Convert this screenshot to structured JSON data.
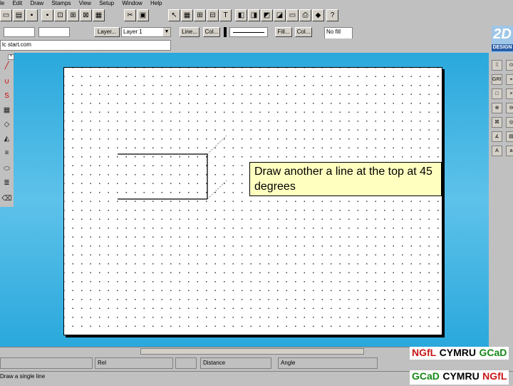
{
  "menu": [
    "le",
    "Edit",
    "Draw",
    "Stamps",
    "View",
    "Setup",
    "Window",
    "Help"
  ],
  "toolbar2": {
    "layer_button": "Layer...",
    "layer_value": "Layer 1",
    "line_button": "Line...",
    "col_button": "Col...",
    "fill_button": "Fill...",
    "fill_col_button": "Col...",
    "fill_value": "No fill"
  },
  "toolbar3": {
    "file_field": "lc start.com"
  },
  "logo": {
    "text": "2D",
    "subtext": "DESIGN"
  },
  "right_panel": [
    "GRID",
    "LOCK",
    "SNAP",
    "DIM",
    "FONT"
  ],
  "left_panel": [
    "LINE",
    "ARC",
    "CURVE",
    "HATCH",
    "BLOCK",
    "TRIM",
    "DIM",
    "MOVE",
    "DEL"
  ],
  "drawing": {
    "tooltip": "Draw another a line at the top at 45 degrees"
  },
  "status": {
    "rel_label": "Rel",
    "distance_label": "Distance",
    "angle_label": "Angle"
  },
  "bottom": {
    "hint": "Draw a single line",
    "brand1": [
      "NGfL",
      "CYMRU",
      "GCaD"
    ],
    "brand2": [
      "GCaD",
      "CYMRU",
      "NGfL"
    ]
  },
  "colors": {
    "desktop": "#2aa8dc",
    "tooltip_bg": "#ffffc0",
    "brand_red": "#c81818",
    "brand_green": "#188818"
  }
}
